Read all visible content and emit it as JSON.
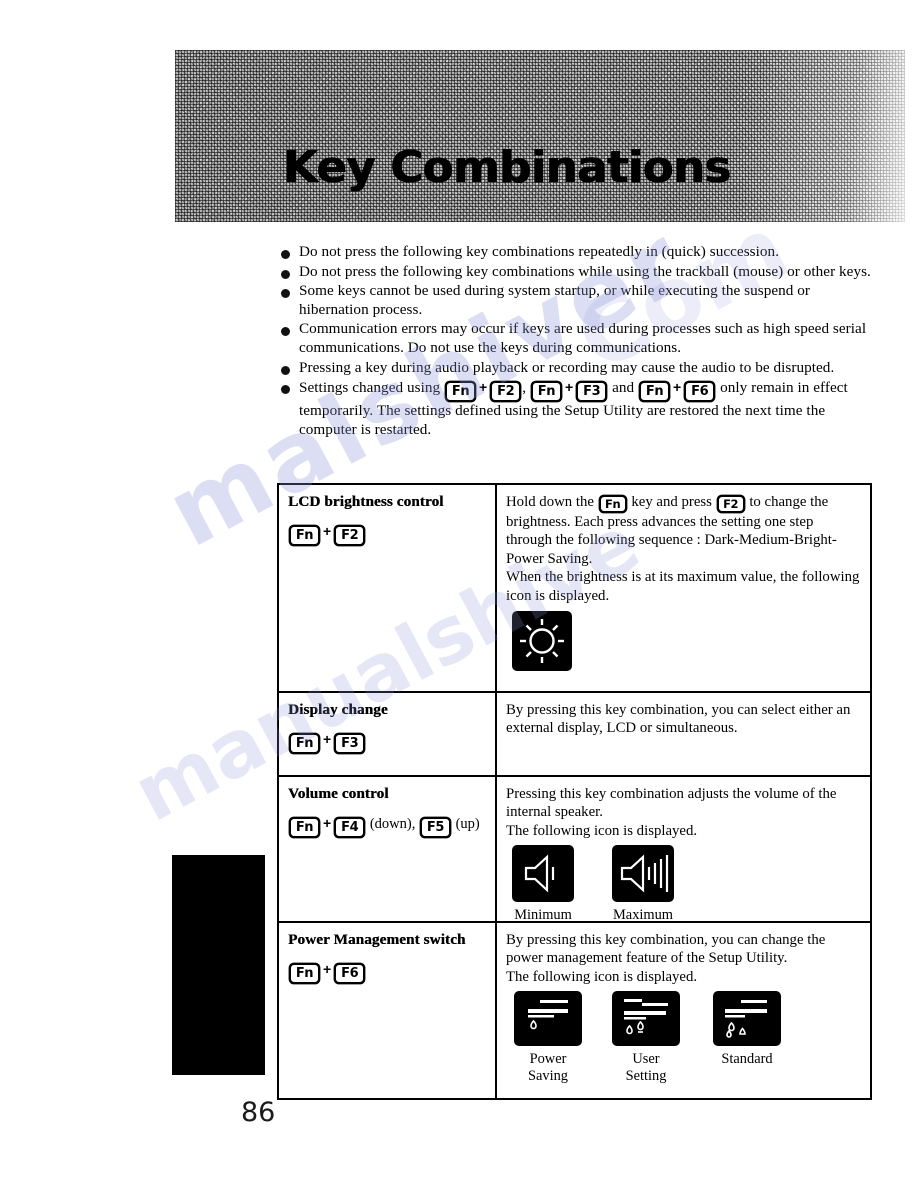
{
  "header": {
    "title": "Key Combinations",
    "banner_color": "#b9b9b9"
  },
  "notes": [
    "Do not press the following key combinations repeatedly in (quick) succession.",
    "Do not press the following key combinations while using the trackball (mouse) or other keys.",
    "Some keys cannot be used during system startup, or while executing the suspend or hibernation process.",
    "Communication errors may occur if keys are used during processes such as high speed serial communications.  Do not use the keys during communications.",
    "Pressing a key during audio playback or recording may cause the audio to be disrupted."
  ],
  "note_last": {
    "lead": "Settings changed using",
    "k1": "Fn",
    "k2": "F2",
    "sep1": ",",
    "k3": "Fn",
    "k4": "F3",
    "sep2": "and",
    "k5": "Fn",
    "k6": "F6",
    "tail": "only remain in effect temporarily. The settings defined using the Setup Utility are restored the next time the computer is restarted."
  },
  "table": {
    "rows": [
      {
        "title": "LCD brightness control",
        "keys": {
          "a": "Fn",
          "plus": "+",
          "b": "F2"
        },
        "body_before": "Hold down the",
        "inline_k1": "Fn",
        "body_mid": "key and press",
        "inline_k2": "F2",
        "body_after": "to change the brightness. Each press advances the setting one step through the following sequence : Dark-Medium-Bright-Power Saving.",
        "body_line2": "When the brightness is at its maximum value, the following icon is displayed.",
        "icons": [
          {
            "name": "brightness-max-icon",
            "caption": ""
          }
        ]
      },
      {
        "title": "Display change",
        "keys": {
          "a": "Fn",
          "plus": "+",
          "b": "F3"
        },
        "body": "By pressing this key combination, you can  select either an external display, LCD or simultaneous.",
        "icons": []
      },
      {
        "title": "Volume control",
        "keys": {
          "a": "Fn",
          "plus": "+",
          "b": "F4",
          "suffix_b": "(down),",
          "c": "F5",
          "suffix_c": "(up)"
        },
        "body": "Pressing this key combination adjusts the volume of the internal speaker.",
        "body_line2": "The following icon is displayed.",
        "icons": [
          {
            "name": "volume-minimum-icon",
            "caption": "Minimum"
          },
          {
            "name": "volume-maximum-icon",
            "caption": "Maximum"
          }
        ]
      },
      {
        "title": "Power Management switch",
        "keys": {
          "a": "Fn",
          "plus": "+",
          "b": "F6"
        },
        "body": "By pressing this key combination, you can change the power management feature of the Setup Utility.",
        "body_line2": "The following icon is displayed.",
        "icons": [
          {
            "name": "power-saving-icon",
            "caption": "Power\nSaving",
            "c1": "Power",
            "c2": "Saving"
          },
          {
            "name": "user-setting-icon",
            "caption": "User\nSetting",
            "c1": "User",
            "c2": "Setting"
          },
          {
            "name": "standard-icon",
            "caption": "Standard",
            "c1": "Standard",
            "c2": ""
          }
        ]
      }
    ]
  },
  "page_number": "86",
  "watermark": {
    "text": "malshiver",
    "text2": "manualshive",
    "text3": "Com",
    "color": "#8e93d8"
  }
}
